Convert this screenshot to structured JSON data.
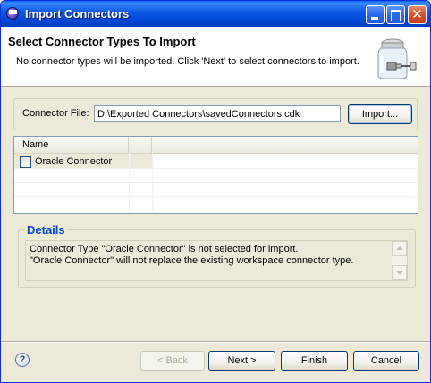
{
  "window": {
    "title": "Import Connectors",
    "icon": "eclipse-icon"
  },
  "title_bar_buttons": {
    "minimize": "minimize-icon",
    "maximize": "maximize-icon",
    "close": "close-icon"
  },
  "banner": {
    "title": "Select Connector Types To Import",
    "description": "No connector types will be imported. Click 'Next' to select connectors to import.",
    "image": "jar-connector-icon"
  },
  "connector_file": {
    "label": "Connector File:",
    "value": "D:\\Exported Connectors\\savedConnectors.cdk",
    "import_button": "Import..."
  },
  "table": {
    "columns": [
      "Name",
      ""
    ],
    "rows": [
      {
        "name": "Oracle Connector",
        "checked": false
      }
    ]
  },
  "details": {
    "title": "Details",
    "lines": [
      "Connector Type \"Oracle Connector\" is not selected for import.",
      "\"Oracle Connector\" will not replace the existing workspace connector type."
    ]
  },
  "footer": {
    "help_icon": "help-icon",
    "back": "< Back",
    "next": "Next >",
    "finish": "Finish",
    "cancel": "Cancel"
  },
  "colors": {
    "title_bar": "#0a5ff5",
    "details_title": "#0046d5",
    "dialog_background": "#ece9d8"
  }
}
